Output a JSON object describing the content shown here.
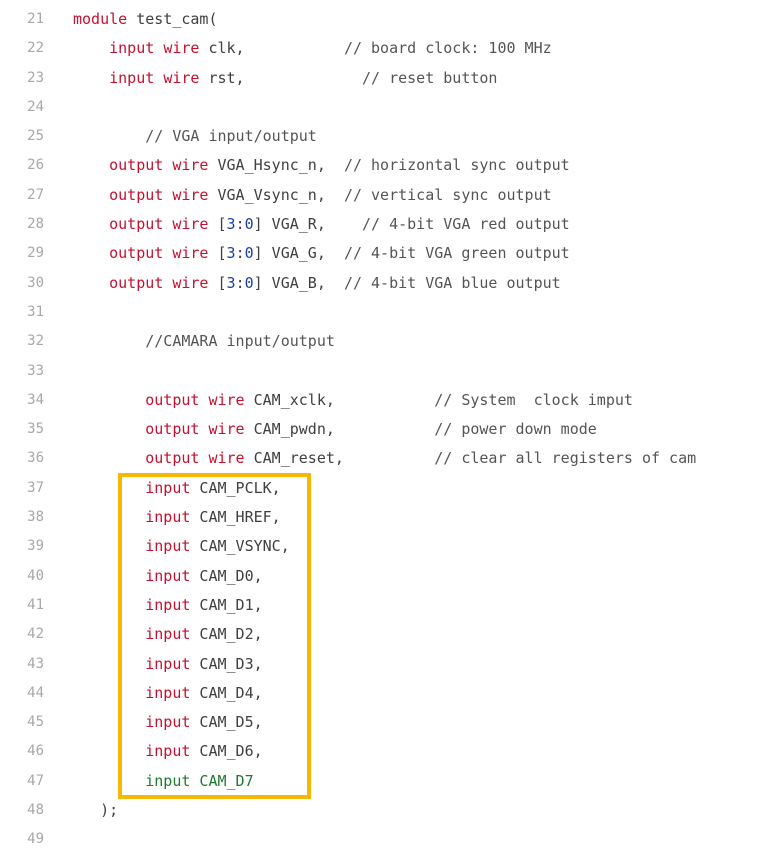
{
  "colors": {
    "keyword": "#c8102e",
    "number": "#1a3ea8",
    "green": "#1f7a2e",
    "text": "#404040",
    "line_number": "#a8a8a8",
    "highlight_border": "#f6b800"
  },
  "lines": [
    {
      "n": "21",
      "tokens": [
        {
          "t": "module",
          "c": "keyword"
        },
        {
          "t": " test_cam(",
          "c": "ident"
        }
      ]
    },
    {
      "n": "22",
      "tokens": [
        {
          "t": "    "
        },
        {
          "t": "input",
          "c": "keyword"
        },
        {
          "t": " "
        },
        {
          "t": "wire",
          "c": "keyword"
        },
        {
          "t": " clk,           ",
          "c": "ident"
        },
        {
          "t": "// board clock: 100 MHz",
          "c": "comment"
        }
      ]
    },
    {
      "n": "23",
      "tokens": [
        {
          "t": "    "
        },
        {
          "t": "input",
          "c": "keyword"
        },
        {
          "t": " "
        },
        {
          "t": "wire",
          "c": "keyword"
        },
        {
          "t": " rst,             ",
          "c": "ident"
        },
        {
          "t": "// reset button",
          "c": "comment"
        }
      ]
    },
    {
      "n": "24",
      "tokens": []
    },
    {
      "n": "25",
      "tokens": [
        {
          "t": "        "
        },
        {
          "t": "// VGA input/output",
          "c": "comment"
        }
      ]
    },
    {
      "n": "26",
      "tokens": [
        {
          "t": "    "
        },
        {
          "t": "output",
          "c": "keyword"
        },
        {
          "t": " "
        },
        {
          "t": "wire",
          "c": "keyword"
        },
        {
          "t": " VGA_Hsync_n,  ",
          "c": "ident"
        },
        {
          "t": "// horizontal sync output",
          "c": "comment"
        }
      ]
    },
    {
      "n": "27",
      "tokens": [
        {
          "t": "    "
        },
        {
          "t": "output",
          "c": "keyword"
        },
        {
          "t": " "
        },
        {
          "t": "wire",
          "c": "keyword"
        },
        {
          "t": " VGA_Vsync_n,  ",
          "c": "ident"
        },
        {
          "t": "// vertical sync output",
          "c": "comment"
        }
      ]
    },
    {
      "n": "28",
      "tokens": [
        {
          "t": "    "
        },
        {
          "t": "output",
          "c": "keyword"
        },
        {
          "t": " "
        },
        {
          "t": "wire",
          "c": "keyword"
        },
        {
          "t": " [",
          "c": "ident"
        },
        {
          "t": "3",
          "c": "number"
        },
        {
          "t": ":",
          "c": "ident"
        },
        {
          "t": "0",
          "c": "number"
        },
        {
          "t": "] VGA_R,    ",
          "c": "ident"
        },
        {
          "t": "// 4-bit VGA red output",
          "c": "comment"
        }
      ]
    },
    {
      "n": "29",
      "tokens": [
        {
          "t": "    "
        },
        {
          "t": "output",
          "c": "keyword"
        },
        {
          "t": " "
        },
        {
          "t": "wire",
          "c": "keyword"
        },
        {
          "t": " [",
          "c": "ident"
        },
        {
          "t": "3",
          "c": "number"
        },
        {
          "t": ":",
          "c": "ident"
        },
        {
          "t": "0",
          "c": "number"
        },
        {
          "t": "] VGA_G,  ",
          "c": "ident"
        },
        {
          "t": "// 4-bit VGA green output",
          "c": "comment"
        }
      ]
    },
    {
      "n": "30",
      "tokens": [
        {
          "t": "    "
        },
        {
          "t": "output",
          "c": "keyword"
        },
        {
          "t": " "
        },
        {
          "t": "wire",
          "c": "keyword"
        },
        {
          "t": " [",
          "c": "ident"
        },
        {
          "t": "3",
          "c": "number"
        },
        {
          "t": ":",
          "c": "ident"
        },
        {
          "t": "0",
          "c": "number"
        },
        {
          "t": "] VGA_B,  ",
          "c": "ident"
        },
        {
          "t": "// 4-bit VGA blue output",
          "c": "comment"
        }
      ]
    },
    {
      "n": "31",
      "tokens": []
    },
    {
      "n": "32",
      "tokens": [
        {
          "t": "        "
        },
        {
          "t": "//CAMARA input/output",
          "c": "comment"
        }
      ]
    },
    {
      "n": "33",
      "tokens": []
    },
    {
      "n": "34",
      "tokens": [
        {
          "t": "        "
        },
        {
          "t": "output",
          "c": "keyword"
        },
        {
          "t": " "
        },
        {
          "t": "wire",
          "c": "keyword"
        },
        {
          "t": " CAM_xclk,           ",
          "c": "ident"
        },
        {
          "t": "// System  clock imput",
          "c": "comment"
        }
      ]
    },
    {
      "n": "35",
      "tokens": [
        {
          "t": "        "
        },
        {
          "t": "output",
          "c": "keyword"
        },
        {
          "t": " "
        },
        {
          "t": "wire",
          "c": "keyword"
        },
        {
          "t": " CAM_pwdn,           ",
          "c": "ident"
        },
        {
          "t": "// power down mode",
          "c": "comment"
        }
      ]
    },
    {
      "n": "36",
      "tokens": [
        {
          "t": "        "
        },
        {
          "t": "output",
          "c": "keyword"
        },
        {
          "t": " "
        },
        {
          "t": "wire",
          "c": "keyword"
        },
        {
          "t": " CAM_reset,          ",
          "c": "ident"
        },
        {
          "t": "// clear all registers of cam",
          "c": "comment"
        }
      ]
    },
    {
      "n": "37",
      "tokens": [
        {
          "t": "        "
        },
        {
          "t": "input",
          "c": "keyword"
        },
        {
          "t": " CAM_PCLK,",
          "c": "ident"
        }
      ]
    },
    {
      "n": "38",
      "tokens": [
        {
          "t": "        "
        },
        {
          "t": "input",
          "c": "keyword"
        },
        {
          "t": " CAM_HREF,",
          "c": "ident"
        }
      ]
    },
    {
      "n": "39",
      "tokens": [
        {
          "t": "        "
        },
        {
          "t": "input",
          "c": "keyword"
        },
        {
          "t": " CAM_VSYNC,",
          "c": "ident"
        }
      ]
    },
    {
      "n": "40",
      "tokens": [
        {
          "t": "        "
        },
        {
          "t": "input",
          "c": "keyword"
        },
        {
          "t": " CAM_D0,",
          "c": "ident"
        }
      ]
    },
    {
      "n": "41",
      "tokens": [
        {
          "t": "        "
        },
        {
          "t": "input",
          "c": "keyword"
        },
        {
          "t": " CAM_D1,",
          "c": "ident"
        }
      ]
    },
    {
      "n": "42",
      "tokens": [
        {
          "t": "        "
        },
        {
          "t": "input",
          "c": "keyword"
        },
        {
          "t": " CAM_D2,",
          "c": "ident"
        }
      ]
    },
    {
      "n": "43",
      "tokens": [
        {
          "t": "        "
        },
        {
          "t": "input",
          "c": "keyword"
        },
        {
          "t": " CAM_D3,",
          "c": "ident"
        }
      ]
    },
    {
      "n": "44",
      "tokens": [
        {
          "t": "        "
        },
        {
          "t": "input",
          "c": "keyword"
        },
        {
          "t": " CAM_D4,",
          "c": "ident"
        }
      ]
    },
    {
      "n": "45",
      "tokens": [
        {
          "t": "        "
        },
        {
          "t": "input",
          "c": "keyword"
        },
        {
          "t": " CAM_D5,",
          "c": "ident"
        }
      ]
    },
    {
      "n": "46",
      "tokens": [
        {
          "t": "        "
        },
        {
          "t": "input",
          "c": "keyword"
        },
        {
          "t": " CAM_D6,",
          "c": "ident"
        }
      ]
    },
    {
      "n": "47",
      "tokens": [
        {
          "t": "        "
        },
        {
          "t": "input CAM_D7",
          "c": "green"
        }
      ]
    },
    {
      "n": "48",
      "tokens": [
        {
          "t": "   "
        },
        {
          "t": ");",
          "c": "ident"
        }
      ]
    },
    {
      "n": "49",
      "tokens": []
    }
  ]
}
